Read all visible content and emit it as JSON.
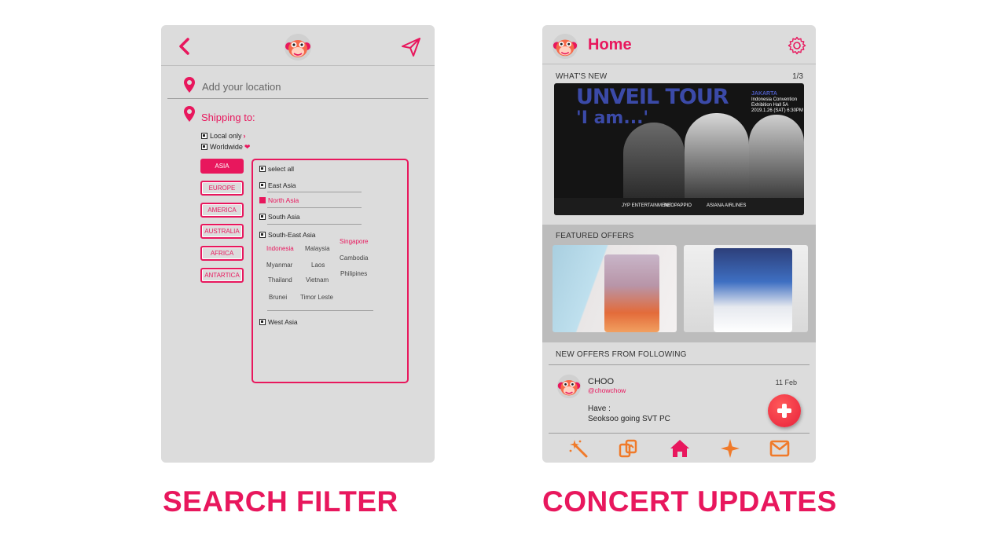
{
  "colors": {
    "accent": "#e8175d",
    "screen_bg": "#dcdcdc",
    "fab": "#f03a3a",
    "nav_icons": "#f07a2a"
  },
  "captions": {
    "left": "SEARCH FILTER",
    "right": "CONCERT UPDATES"
  },
  "filter": {
    "icons": {
      "back": "chevron-left-icon",
      "logo": "monkey-logo-icon",
      "send": "paper-plane-icon"
    },
    "location_placeholder": "Add your location",
    "shipping_label": "Shipping to:",
    "options": [
      {
        "label": "Local only"
      },
      {
        "label": "Worldwide"
      }
    ],
    "regions": [
      "ASIA",
      "EUROPE",
      "AMERICA",
      "AUSTRALIA",
      "AFRICA",
      "ANTARTICA"
    ],
    "active_region": "ASIA",
    "subregions": {
      "select_all": "select all",
      "east_asia": "East Asia",
      "north_asia": "North Asia",
      "south_asia": "South Asia",
      "south_east_asia": "South-East Asia",
      "west_asia": "West Asia"
    },
    "countries": {
      "indonesia": "Indonesia",
      "malaysia": "Malaysia",
      "singapore": "Singapore",
      "myanmar": "Myanmar",
      "laos": "Laos",
      "cambodia": "Cambodia",
      "thailand": "Thailand",
      "vietnam": "Vietnam",
      "philipines": "Philipines",
      "brunei": "Brunei",
      "timor_leste": "Timor Leste"
    }
  },
  "home": {
    "title": "Home",
    "whats_new_label": "WHAT'S NEW",
    "page_count": "1/3",
    "banner": {
      "title": "UNVEIL TOUR",
      "subtitle": "'I am...'",
      "city": "JAKARTA",
      "venue_line1": "Indonesia Convention",
      "venue_line2": "Exhibition Hall 5A",
      "date": "2019.1.26 (SAT) 6:30PM",
      "sponsor1": "JYP ENTERTAINMENT",
      "sponsor2": "NEOPAPPIO",
      "sponsor3": "ASIANA AIRLINES"
    },
    "featured_label": "FEATURED OFFERS",
    "following_label": "NEW OFFERS FROM FOLLOWING",
    "post": {
      "name": "CHOO",
      "handle": "@chowchow",
      "date": "11 Feb",
      "have_label": "Have :",
      "item": "Seoksoo going SVT PC"
    },
    "nav": [
      "sparkle-wand-icon",
      "swap-cards-icon",
      "home-icon",
      "star-icon",
      "mail-icon"
    ]
  }
}
